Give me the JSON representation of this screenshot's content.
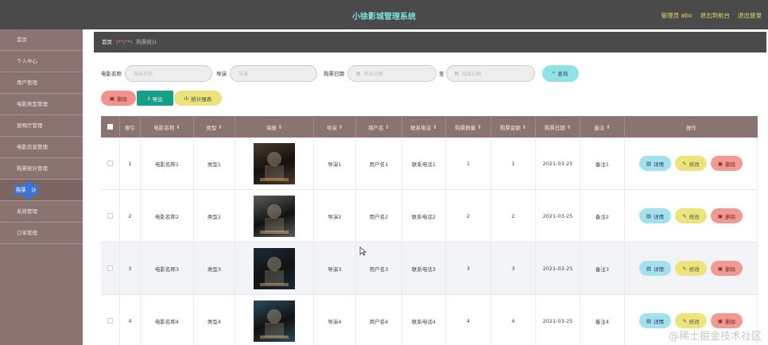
{
  "header": {
    "title": "小徐影城管理系统",
    "admin": "管理员 abo",
    "back_front": "退出到前台",
    "logout": "退出登录"
  },
  "sidebar": {
    "items": [
      {
        "label": "首页"
      },
      {
        "label": "个人中心"
      },
      {
        "label": "用户管理"
      },
      {
        "label": "电影类型管理"
      },
      {
        "label": "放映厅管理"
      },
      {
        "label": "电影信息管理"
      },
      {
        "label": "购票统计管理"
      },
      {
        "label": "购票统计"
      },
      {
        "label": "系统管理"
      },
      {
        "label": "订单管理"
      }
    ]
  },
  "breadcrumb": {
    "home": "首页",
    "emoticon": "(*'▽'*)",
    "current": "购票统计"
  },
  "search": {
    "movie_label": "电影名称",
    "movie_placeholder": "电影名称",
    "director_label": "导演",
    "director_placeholder": "导演",
    "date_label": "购票日期",
    "date_start_placeholder": "开始日期",
    "to_label": "至",
    "date_end_placeholder": "结束日期",
    "query_button": "查询"
  },
  "actions": {
    "delete": "删除",
    "export": "导出",
    "report": "统计报表"
  },
  "table": {
    "columns": [
      "索引",
      "电影名称",
      "类型",
      "海报",
      "导演",
      "用户名",
      "联系电话",
      "购票数量",
      "购票金额",
      "购票日期",
      "备注",
      "操作"
    ],
    "rows": [
      {
        "index": "1",
        "movie": "电影名称1",
        "type": "类型1",
        "director": "导演1",
        "user": "用户名1",
        "phone": "联系电话1",
        "qty": "1",
        "amount": "1",
        "date": "2021-03-25",
        "remark": "备注1",
        "poster_color": "#4a3a2a"
      },
      {
        "index": "2",
        "movie": "电影名称2",
        "type": "类型2",
        "director": "导演2",
        "user": "用户名2",
        "phone": "联系电话2",
        "qty": "2",
        "amount": "2",
        "date": "2021-03-25",
        "remark": "备注2",
        "poster_color": "#5a5e5a"
      },
      {
        "index": "3",
        "movie": "电影名称3",
        "type": "类型3",
        "director": "导演3",
        "user": "用户名3",
        "phone": "联系电话3",
        "qty": "3",
        "amount": "3",
        "date": "2021-03-25",
        "remark": "备注3",
        "poster_color": "#1a2a3a"
      },
      {
        "index": "4",
        "movie": "电影名称4",
        "type": "类型4",
        "director": "导演4",
        "user": "用户名4",
        "phone": "联系电话4",
        "qty": "4",
        "amount": "4",
        "date": "2021-03-25",
        "remark": "备注4",
        "poster_color": "#2a4a5a"
      }
    ],
    "op_detail": "详情",
    "op_edit": "修改",
    "op_delete": "删除"
  },
  "watermark": "@稀土掘金技术社区"
}
